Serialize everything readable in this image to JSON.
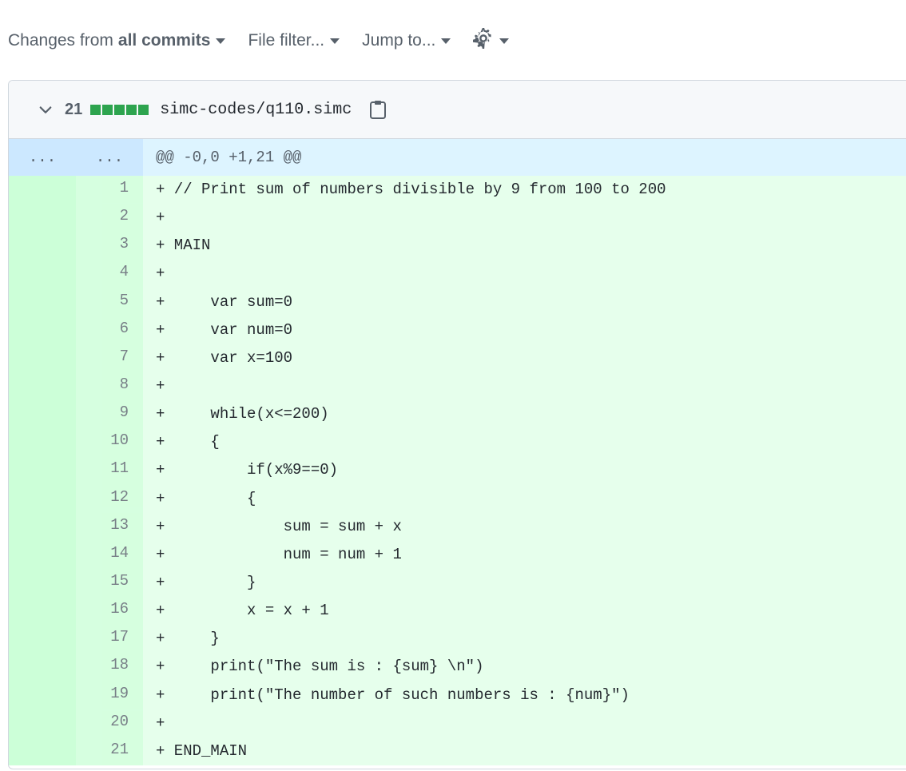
{
  "toolbar": {
    "changes_prefix": "Changes from",
    "changes_value": "all commits",
    "file_filter": "File filter...",
    "jump_to": "Jump to..."
  },
  "file": {
    "additions": "21",
    "filename": "simc-codes/q110.simc"
  },
  "hunk": {
    "old_ellipsis": "...",
    "new_ellipsis": "...",
    "header": "@@ -0,0 +1,21 @@"
  },
  "lines": [
    {
      "num": "1",
      "text": "+ // Print sum of numbers divisible by 9 from 100 to 200"
    },
    {
      "num": "2",
      "text": "+"
    },
    {
      "num": "3",
      "text": "+ MAIN"
    },
    {
      "num": "4",
      "text": "+"
    },
    {
      "num": "5",
      "text": "+     var sum=0"
    },
    {
      "num": "6",
      "text": "+     var num=0"
    },
    {
      "num": "7",
      "text": "+     var x=100"
    },
    {
      "num": "8",
      "text": "+"
    },
    {
      "num": "9",
      "text": "+     while(x<=200)"
    },
    {
      "num": "10",
      "text": "+     {"
    },
    {
      "num": "11",
      "text": "+         if(x%9==0)"
    },
    {
      "num": "12",
      "text": "+         {"
    },
    {
      "num": "13",
      "text": "+             sum = sum + x"
    },
    {
      "num": "14",
      "text": "+             num = num + 1"
    },
    {
      "num": "15",
      "text": "+         }"
    },
    {
      "num": "16",
      "text": "+         x = x + 1"
    },
    {
      "num": "17",
      "text": "+     }"
    },
    {
      "num": "18",
      "text": "+     print(\"The sum is : {sum} \\n\")"
    },
    {
      "num": "19",
      "text": "+     print(\"The number of such numbers is : {num}\")"
    },
    {
      "num": "20",
      "text": "+"
    },
    {
      "num": "21",
      "text": "+ END_MAIN"
    }
  ],
  "colors": {
    "addition_bg": "#e6ffec",
    "addition_gutter": "#ccffd8",
    "hunk_bg": "#ddf4ff",
    "diffstat_green": "#2da44e"
  },
  "icons": [
    "chevron-down-icon",
    "gear-icon",
    "clipboard-icon",
    "caret-down-icon"
  ]
}
